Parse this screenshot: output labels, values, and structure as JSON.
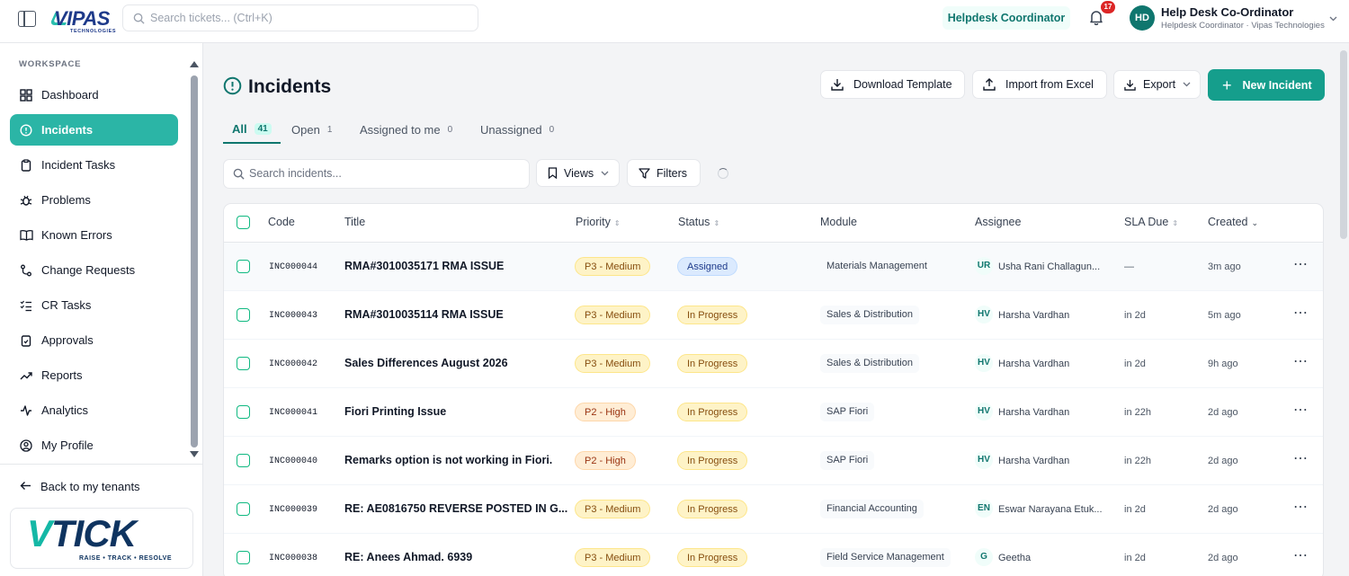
{
  "topbar": {
    "logo_text": "VIPAS",
    "logo_sub": "TECHNOLOGIES",
    "search_placeholder": "Search tickets... (Ctrl+K)",
    "role": "Helpdesk Coordinator",
    "notification_count": "17",
    "avatar_initials": "HD",
    "user_name": "Help Desk Co-Ordinator",
    "user_subtitle": "Helpdesk Coordinator · Vipas Technologies"
  },
  "sidebar": {
    "section_label": "WORKSPACE",
    "items": [
      {
        "label": "Dashboard",
        "icon": "dashboard-icon"
      },
      {
        "label": "Incidents",
        "icon": "alert-circle-icon",
        "active": true
      },
      {
        "label": "Incident Tasks",
        "icon": "clipboard-icon"
      },
      {
        "label": "Problems",
        "icon": "bug-icon"
      },
      {
        "label": "Known Errors",
        "icon": "book-icon"
      },
      {
        "label": "Change Requests",
        "icon": "git-branch-icon"
      },
      {
        "label": "CR Tasks",
        "icon": "list-check-icon"
      },
      {
        "label": "Approvals",
        "icon": "clipboard-check-icon"
      },
      {
        "label": "Reports",
        "icon": "trend-icon"
      },
      {
        "label": "Analytics",
        "icon": "activity-icon"
      },
      {
        "label": "My Profile",
        "icon": "user-circle-icon"
      }
    ],
    "back_label": "Back to my tenants",
    "brand_word": "TICK",
    "brand_v": "V",
    "brand_tagline": "RAISE  • TRACK  • RESOLVE"
  },
  "page": {
    "title": "Incidents",
    "buttons": {
      "download_template": "Download Template",
      "import_excel": "Import from Excel",
      "export": "Export",
      "new_incident": "New Incident"
    },
    "tabs": [
      {
        "label": "All",
        "count": "41",
        "active": true
      },
      {
        "label": "Open",
        "count": "1"
      },
      {
        "label": "Assigned to me",
        "count": "0"
      },
      {
        "label": "Unassigned",
        "count": "0"
      }
    ],
    "search_placeholder": "Search incidents...",
    "views_label": "Views",
    "filters_label": "Filters"
  },
  "table": {
    "columns": [
      "Code",
      "Title",
      "Priority",
      "Status",
      "Module",
      "Assignee",
      "SLA Due",
      "Created"
    ],
    "rows": [
      {
        "code": "INC000044",
        "title": "RMA#3010035171 RMA ISSUE",
        "priority": "P3 - Medium",
        "status": "Assigned",
        "module": "Materials Management",
        "initials": "UR",
        "assignee": "Usha Rani Challagun...",
        "sla": "—",
        "created": "3m ago"
      },
      {
        "code": "INC000043",
        "title": "RMA#3010035114 RMA ISSUE",
        "priority": "P3 - Medium",
        "status": "In Progress",
        "module": "Sales & Distribution",
        "initials": "HV",
        "assignee": "Harsha Vardhan",
        "sla": "in 2d",
        "created": "5m ago"
      },
      {
        "code": "INC000042",
        "title": "Sales Differences August 2026",
        "priority": "P3 - Medium",
        "status": "In Progress",
        "module": "Sales & Distribution",
        "initials": "HV",
        "assignee": "Harsha Vardhan",
        "sla": "in 2d",
        "created": "9h ago"
      },
      {
        "code": "INC000041",
        "title": "Fiori Printing Issue",
        "priority": "P2 - High",
        "status": "In Progress",
        "module": "SAP Fiori",
        "initials": "HV",
        "assignee": "Harsha Vardhan",
        "sla": "in 22h",
        "created": "2d ago"
      },
      {
        "code": "INC000040",
        "title": "Remarks option is not working in Fiori.",
        "priority": "P2 - High",
        "status": "In Progress",
        "module": "SAP Fiori",
        "initials": "HV",
        "assignee": "Harsha Vardhan",
        "sla": "in 22h",
        "created": "2d ago"
      },
      {
        "code": "INC000039",
        "title": "RE: AE0816750 REVERSE POSTED IN G...",
        "priority": "P3 - Medium",
        "status": "In Progress",
        "module": "Financial Accounting",
        "initials": "EN",
        "assignee": "Eswar Narayana Etuk...",
        "sla": "in 2d",
        "created": "2d ago"
      },
      {
        "code": "INC000038",
        "title": "RE: Anees Ahmad. 6939",
        "priority": "P3 - Medium",
        "status": "In Progress",
        "module": "Field Service Management",
        "initials": "G",
        "assignee": "Geetha",
        "sla": "in 2d",
        "created": "2d ago"
      }
    ]
  }
}
